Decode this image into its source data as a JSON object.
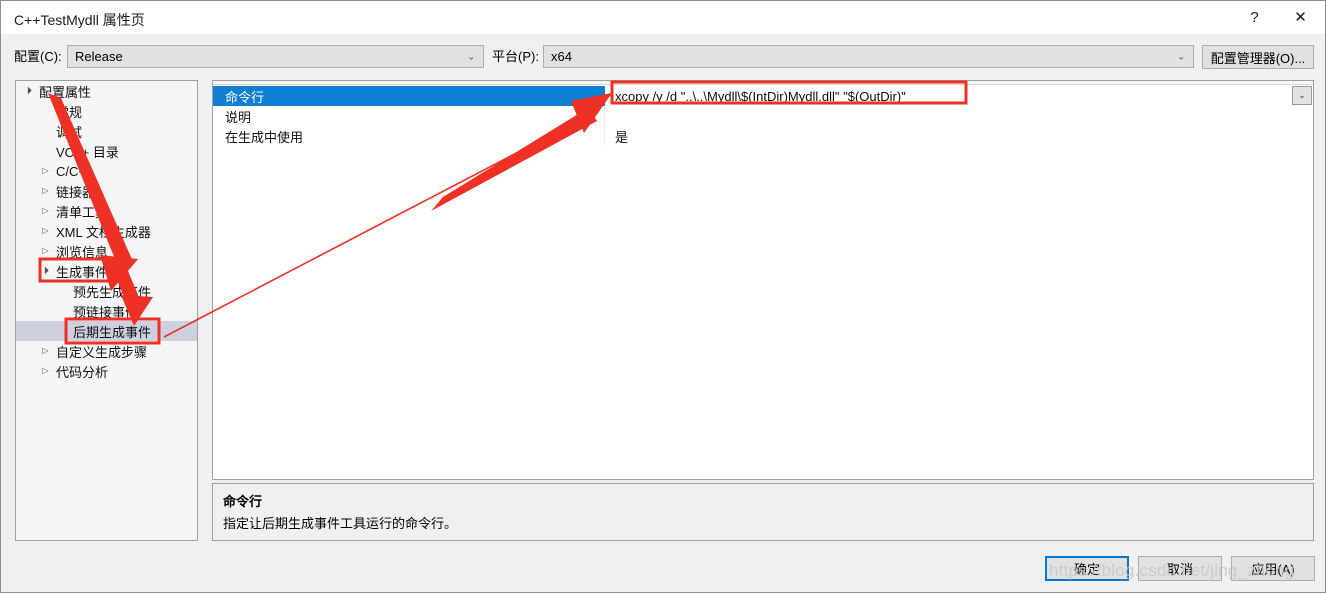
{
  "window": {
    "title": "C++TestMydll 属性页",
    "help_icon": "?",
    "close_icon": "✕"
  },
  "config_bar": {
    "config_label": "配置(C):",
    "config_value": "Release",
    "platform_label": "平台(P):",
    "platform_value": "x64",
    "config_manager_button": "配置管理器(O)...",
    "chevron_icon": "⌄"
  },
  "tree": {
    "items": [
      {
        "label": "配置属性",
        "indent": 0,
        "twisty": "▲",
        "selected": false
      },
      {
        "label": "常规",
        "indent": 1,
        "twisty": "",
        "selected": false
      },
      {
        "label": "调试",
        "indent": 1,
        "twisty": "",
        "selected": false
      },
      {
        "label": "VC++ 目录",
        "indent": 1,
        "twisty": "",
        "selected": false
      },
      {
        "label": "C/C++",
        "indent": 1,
        "twisty": "▷",
        "selected": false
      },
      {
        "label": "链接器",
        "indent": 1,
        "twisty": "▷",
        "selected": false
      },
      {
        "label": "清单工具",
        "indent": 1,
        "twisty": "▷",
        "selected": false
      },
      {
        "label": "XML 文档生成器",
        "indent": 1,
        "twisty": "▷",
        "selected": false
      },
      {
        "label": "浏览信息",
        "indent": 1,
        "twisty": "▷",
        "selected": false
      },
      {
        "label": "生成事件",
        "indent": 1,
        "twisty": "▲",
        "selected": false
      },
      {
        "label": "预先生成事件",
        "indent": 2,
        "twisty": "",
        "selected": false
      },
      {
        "label": "预链接事件",
        "indent": 2,
        "twisty": "",
        "selected": false
      },
      {
        "label": "后期生成事件",
        "indent": 2,
        "twisty": "",
        "selected": true
      },
      {
        "label": "自定义生成步骤",
        "indent": 1,
        "twisty": "▷",
        "selected": false
      },
      {
        "label": "代码分析",
        "indent": 1,
        "twisty": "▷",
        "selected": false
      }
    ]
  },
  "grid": {
    "rows": [
      {
        "name": "命令行",
        "value": "xcopy /y /d \"..\\..\\Mydll\\$(IntDir)Mydll.dll\" \"$(OutDir)\"",
        "selected": true
      },
      {
        "name": "说明",
        "value": "",
        "selected": false
      },
      {
        "name": "在生成中使用",
        "value": "是",
        "selected": false
      }
    ],
    "value_dropdown_icon": "⌄"
  },
  "description": {
    "title": "命令行",
    "body": "指定让后期生成事件工具运行的命令行。"
  },
  "footer": {
    "ok": "确定",
    "cancel": "取消",
    "apply": "应用(A)"
  },
  "watermark": "https://blog.csdn.net/jing_zhong",
  "annotation_color": "#ee3124"
}
